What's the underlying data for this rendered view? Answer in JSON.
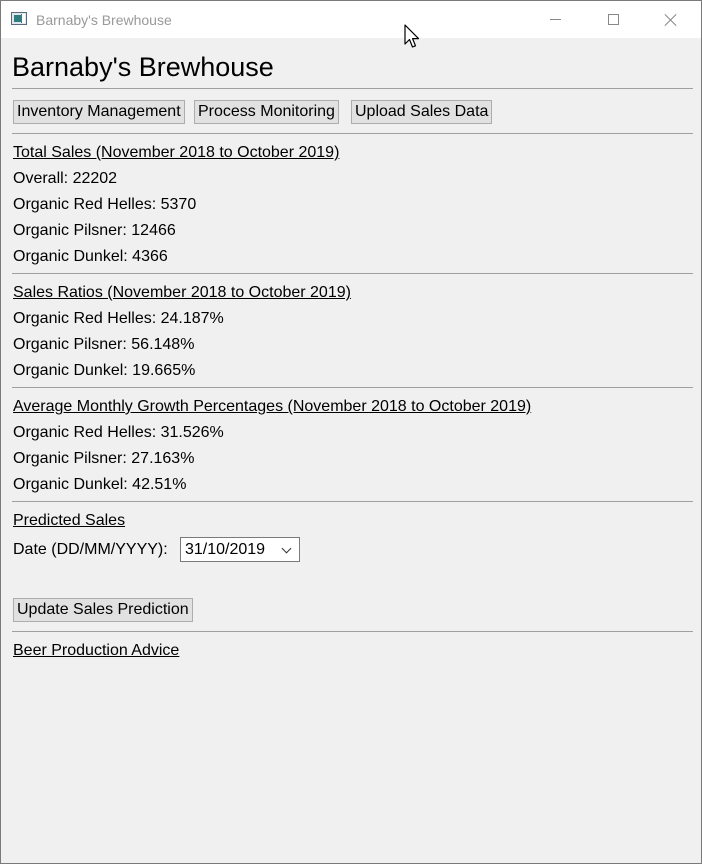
{
  "window": {
    "title": "Barnaby's Brewhouse"
  },
  "header": {
    "title": "Barnaby's Brewhouse"
  },
  "toolbar": {
    "inventory_label": "Inventory Management",
    "process_label": "Process Monitoring",
    "upload_label": "Upload Sales Data"
  },
  "total_sales": {
    "title": "Total Sales (November 2018 to October 2019)",
    "lines": [
      "Overall: 22202",
      "Organic Red Helles: 5370",
      "Organic Pilsner: 12466",
      "Organic Dunkel: 4366"
    ]
  },
  "sales_ratios": {
    "title": "Sales Ratios (November 2018 to October 2019)",
    "lines": [
      "Organic Red Helles: 24.187%",
      "Organic Pilsner: 56.148%",
      "Organic Dunkel: 19.665%"
    ]
  },
  "growth": {
    "title": "Average Monthly Growth Percentages (November 2018 to October 2019)",
    "lines": [
      "Organic Red Helles: 31.526%",
      "Organic Pilsner: 27.163%",
      "Organic Dunkel: 42.51%"
    ]
  },
  "prediction": {
    "title": "Predicted Sales",
    "date_label": "Date (DD/MM/YYYY):",
    "date_value": "31/10/2019",
    "update_label": "Update Sales Prediction"
  },
  "advice": {
    "title": "Beer Production Advice"
  },
  "icons": {
    "app": "app-window-icon",
    "minimize": "minimize-icon",
    "maximize": "maximize-icon",
    "close": "close-icon",
    "dropdown": "chevron-down-icon",
    "cursor": "mouse-cursor-icon"
  }
}
